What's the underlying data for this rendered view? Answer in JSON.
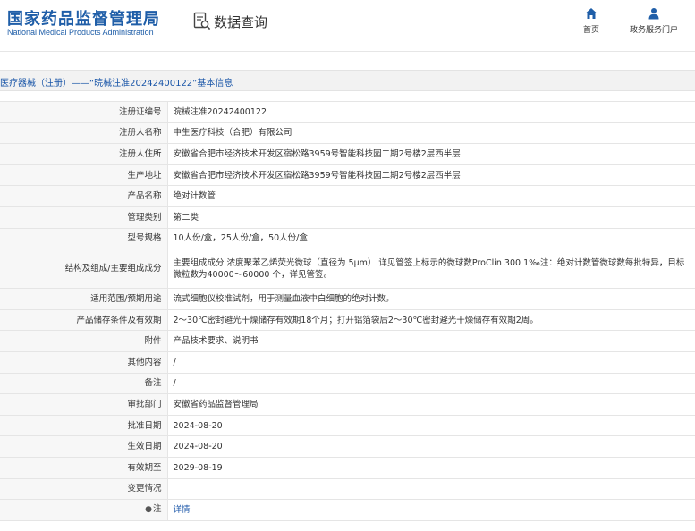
{
  "header": {
    "logo_cn": "国家药品监督管理局",
    "logo_en": "National Medical Products Administration",
    "query_title": "数据查询",
    "nav": [
      {
        "label": "首页",
        "icon": "home-icon"
      },
      {
        "label": "政务服务门户",
        "icon": "user-icon"
      }
    ]
  },
  "breadcrumb": "医疗器械（注册）——“晥械注准20242400122”基本信息",
  "rows": [
    {
      "label": "注册证编号",
      "value": "晥械注准20242400122"
    },
    {
      "label": "注册人名称",
      "value": "中生医疗科技（合肥）有限公司"
    },
    {
      "label": "注册人住所",
      "value": "安徽省合肥市经济技术开发区宿松路3959号智能科技园二期2号楼2层西半层"
    },
    {
      "label": "生产地址",
      "value": "安徽省合肥市经济技术开发区宿松路3959号智能科技园二期2号楼2层西半层"
    },
    {
      "label": "产品名称",
      "value": "绝对计数管"
    },
    {
      "label": "管理类别",
      "value": "第二类"
    },
    {
      "label": "型号规格",
      "value": "10人份/盒，25人份/盒，50人份/盒"
    },
    {
      "label": "结构及组成/主要组成成分",
      "value": "主要组成成分 浓度聚苯乙烯荧光微球（直径为 5μm） 详见管签上标示的微球数ProClin 300 1‰注：绝对计数管微球数每批特异，目标微粒数为40000～60000 个，详见管签。"
    },
    {
      "label": "适用范围/预期用途",
      "value": "流式细胞仪校准试剂，用于测量血液中白细胞的绝对计数。"
    },
    {
      "label": "产品储存条件及有效期",
      "value": "2～30℃密封避光干燥储存有效期18个月；打开铝箔袋后2～30℃密封避光干燥储存有效期2周。"
    },
    {
      "label": "附件",
      "value": "产品技术要求、说明书"
    },
    {
      "label": "其他内容",
      "value": "/"
    },
    {
      "label": "备注",
      "value": "/"
    },
    {
      "label": "审批部门",
      "value": "安徽省药品监督管理局"
    },
    {
      "label": "批准日期",
      "value": "2024-08-20"
    },
    {
      "label": "生效日期",
      "value": "2024-08-20"
    },
    {
      "label": "有效期至",
      "value": "2029-08-19"
    },
    {
      "label": "变更情况",
      "value": ""
    },
    {
      "label": "注",
      "value": "详情"
    }
  ]
}
